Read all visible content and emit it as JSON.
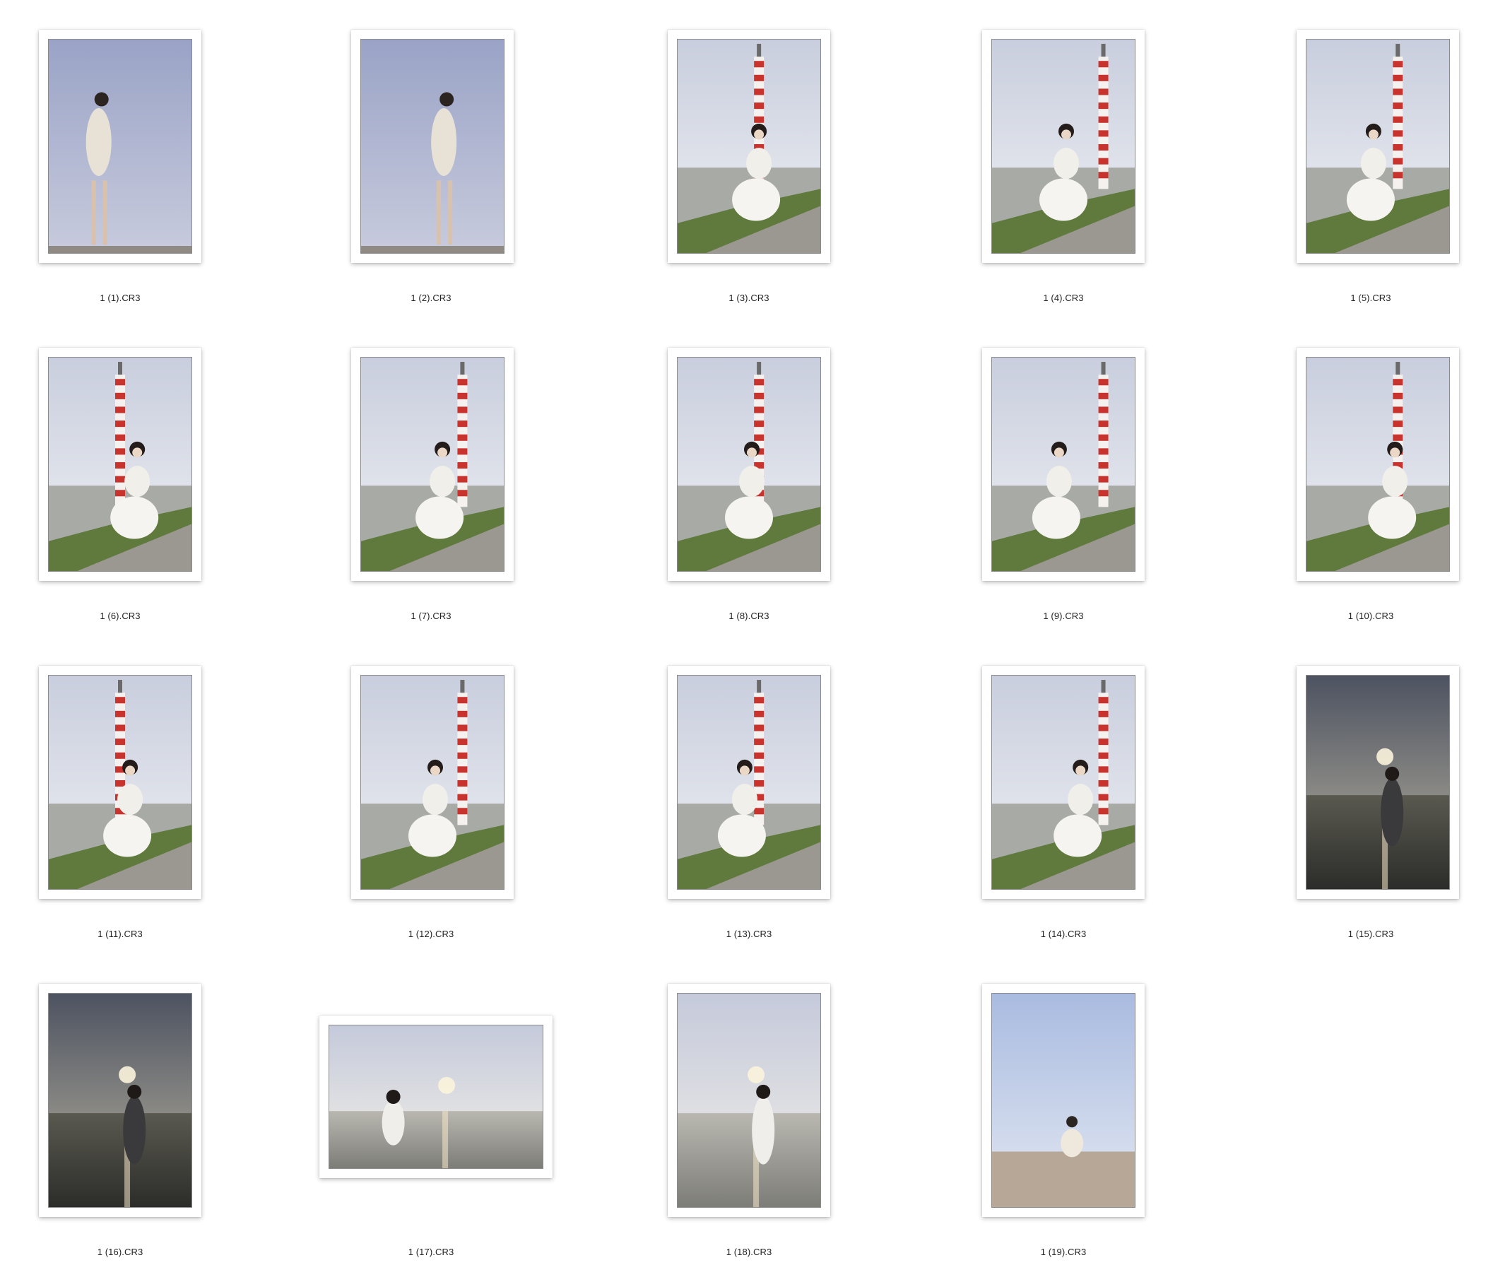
{
  "files": [
    {
      "name": "1 (1).CR3",
      "scene": "walk"
    },
    {
      "name": "1 (2).CR3",
      "scene": "walk"
    },
    {
      "name": "1 (3).CR3",
      "scene": "pole"
    },
    {
      "name": "1 (4).CR3",
      "scene": "pole"
    },
    {
      "name": "1 (5).CR3",
      "scene": "pole"
    },
    {
      "name": "1 (6).CR3",
      "scene": "pole"
    },
    {
      "name": "1 (7).CR3",
      "scene": "pole"
    },
    {
      "name": "1 (8).CR3",
      "scene": "pole"
    },
    {
      "name": "1 (9).CR3",
      "scene": "pole"
    },
    {
      "name": "1 (10).CR3",
      "scene": "pole"
    },
    {
      "name": "1 (11).CR3",
      "scene": "pole"
    },
    {
      "name": "1 (12).CR3",
      "scene": "pole"
    },
    {
      "name": "1 (13).CR3",
      "scene": "pole"
    },
    {
      "name": "1 (14).CR3",
      "scene": "pole"
    },
    {
      "name": "1 (15).CR3",
      "scene": "sunset"
    },
    {
      "name": "1 (16).CR3",
      "scene": "sunset"
    },
    {
      "name": "1 (17).CR3",
      "scene": "landscape"
    },
    {
      "name": "1 (18).CR3",
      "scene": "sunset-bright"
    },
    {
      "name": "1 (19).CR3",
      "scene": "wall"
    }
  ]
}
